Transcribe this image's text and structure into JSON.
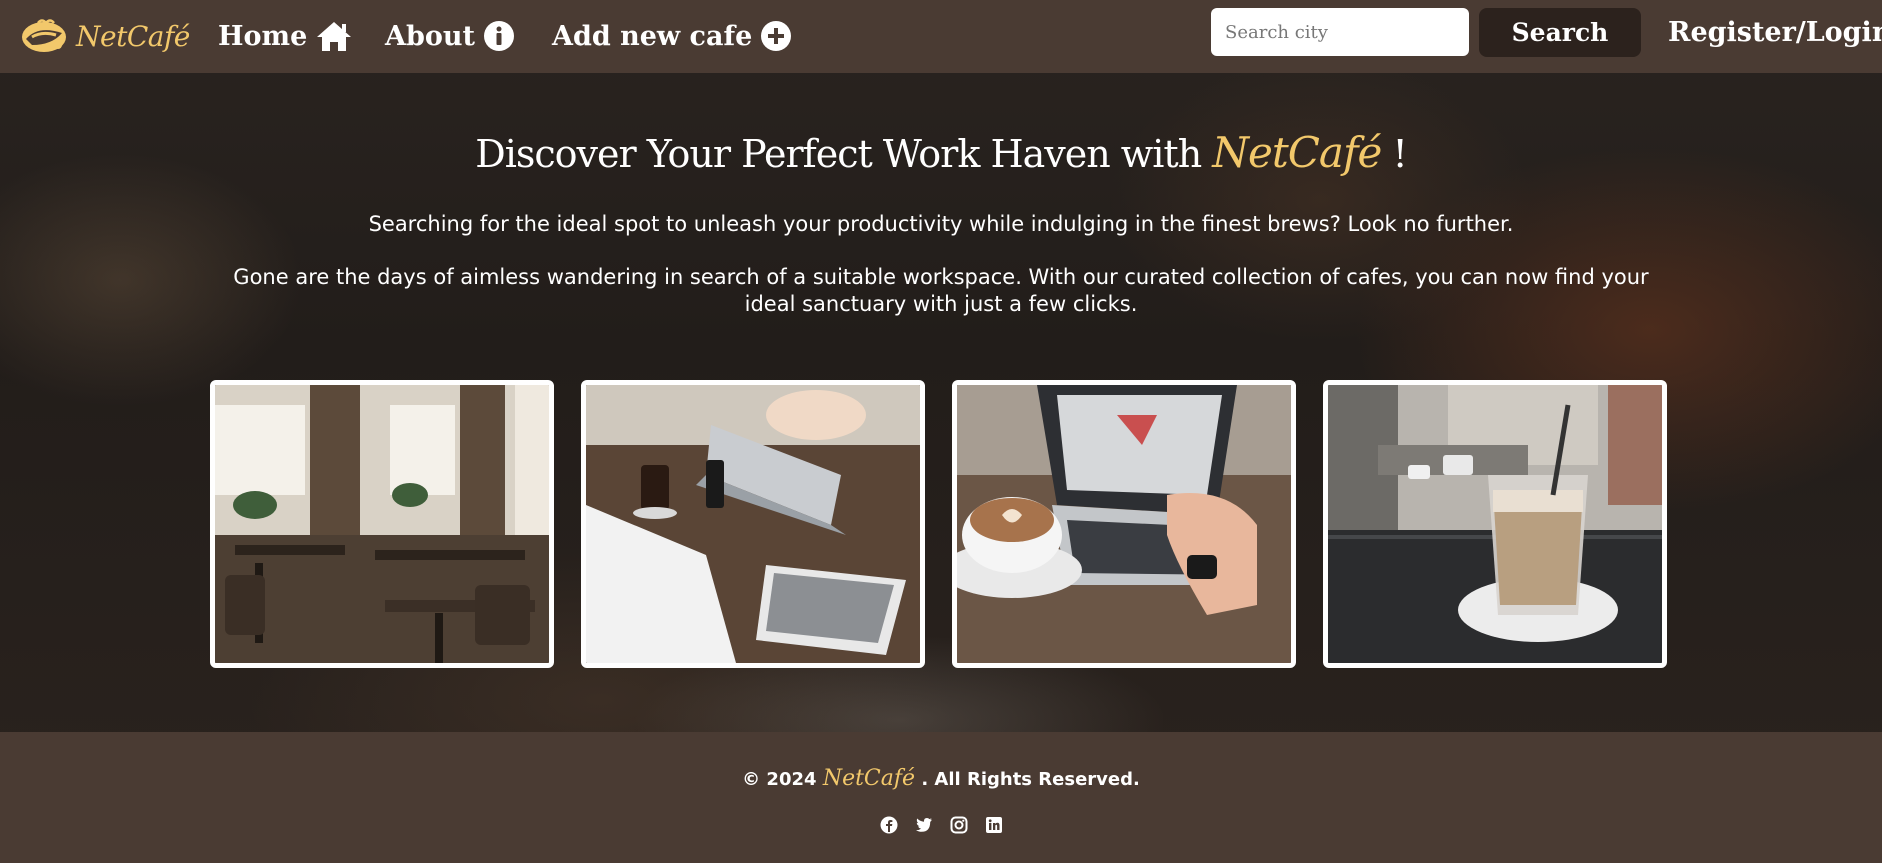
{
  "navbar": {
    "brand": "NetCafé",
    "links": [
      {
        "label": "Home",
        "icon": "home-icon"
      },
      {
        "label": "About",
        "icon": "info-icon"
      },
      {
        "label": "Add new cafe",
        "icon": "plus-circle-icon"
      }
    ],
    "search": {
      "placeholder": "Search city",
      "value": "",
      "button_label": "Search"
    },
    "login_label": "Register/Login"
  },
  "hero": {
    "title_prefix": "Discover Your Perfect Work Haven with",
    "title_brand": "NetCafé",
    "title_suffix": "!",
    "paragraph1": "Searching for the ideal spot to unleash your productivity while indulging in the finest brews? Look no further.",
    "paragraph2": "Gone are the days of aimless wandering in search of a suitable workspace. With our curated collection of cafes, you can now find your ideal sanctuary with just a few clicks."
  },
  "gallery": [
    {
      "name": "cafe-interior-photo"
    },
    {
      "name": "people-with-laptop-photo"
    },
    {
      "name": "coffee-and-laptop-photo"
    },
    {
      "name": "latte-by-window-photo"
    }
  ],
  "footer": {
    "copyright_prefix": "© 2024",
    "brand": "NetCafé",
    "copyright_suffix": ". All Rights Reserved.",
    "socials": [
      "facebook-icon",
      "twitter-icon",
      "instagram-icon",
      "linkedin-icon"
    ]
  },
  "colors": {
    "nav_bg": "#4a3b33",
    "brand_gold": "#f2c86b",
    "search_button_bg": "#2c221d",
    "card_border": "#ffffff"
  }
}
